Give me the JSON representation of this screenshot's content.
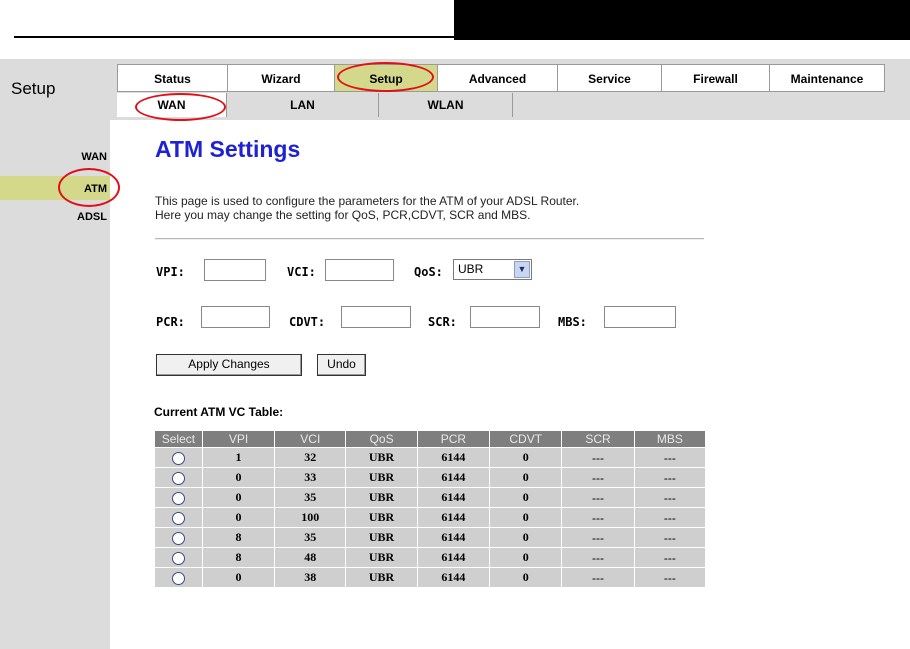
{
  "header": {
    "section_title": "Setup"
  },
  "main_tabs": [
    {
      "label": "Status",
      "active": false
    },
    {
      "label": "Wizard",
      "active": false
    },
    {
      "label": "Setup",
      "active": true
    },
    {
      "label": "Advanced",
      "active": false
    },
    {
      "label": "Service",
      "active": false
    },
    {
      "label": "Firewall",
      "active": false
    },
    {
      "label": "Maintenance",
      "active": false
    }
  ],
  "sub_tabs": [
    {
      "label": "WAN",
      "active": true
    },
    {
      "label": "LAN",
      "active": false
    },
    {
      "label": "WLAN",
      "active": false
    }
  ],
  "sidebar": {
    "items": [
      {
        "label": "WAN",
        "active": false
      },
      {
        "label": "ATM",
        "active": true
      },
      {
        "label": "ADSL",
        "active": false
      }
    ]
  },
  "page": {
    "title": "ATM Settings",
    "description_line1": "This page is used to configure the parameters for the ATM of your ADSL Router.",
    "description_line2": "Here you may change the setting for QoS, PCR,CDVT, SCR and MBS."
  },
  "form": {
    "vpi_label": "VPI:",
    "vpi_value": "",
    "vci_label": "VCI:",
    "vci_value": "",
    "qos_label": "QoS:",
    "qos_value": "UBR",
    "pcr_label": "PCR:",
    "pcr_value": "",
    "cdvt_label": "CDVT:",
    "cdvt_value": "",
    "scr_label": "SCR:",
    "scr_value": "",
    "mbs_label": "MBS:",
    "mbs_value": "",
    "apply_label": "Apply Changes",
    "undo_label": "Undo"
  },
  "table": {
    "caption": "Current ATM VC Table:",
    "headers": [
      "Select",
      "VPI",
      "VCI",
      "QoS",
      "PCR",
      "CDVT",
      "SCR",
      "MBS"
    ],
    "rows": [
      {
        "vpi": "1",
        "vci": "32",
        "qos": "UBR",
        "pcr": "6144",
        "cdvt": "0",
        "scr": "---",
        "mbs": "---"
      },
      {
        "vpi": "0",
        "vci": "33",
        "qos": "UBR",
        "pcr": "6144",
        "cdvt": "0",
        "scr": "---",
        "mbs": "---"
      },
      {
        "vpi": "0",
        "vci": "35",
        "qos": "UBR",
        "pcr": "6144",
        "cdvt": "0",
        "scr": "---",
        "mbs": "---"
      },
      {
        "vpi": "0",
        "vci": "100",
        "qos": "UBR",
        "pcr": "6144",
        "cdvt": "0",
        "scr": "---",
        "mbs": "---"
      },
      {
        "vpi": "8",
        "vci": "35",
        "qos": "UBR",
        "pcr": "6144",
        "cdvt": "0",
        "scr": "---",
        "mbs": "---"
      },
      {
        "vpi": "8",
        "vci": "48",
        "qos": "UBR",
        "pcr": "6144",
        "cdvt": "0",
        "scr": "---",
        "mbs": "---"
      },
      {
        "vpi": "0",
        "vci": "38",
        "qos": "UBR",
        "pcr": "6144",
        "cdvt": "0",
        "scr": "---",
        "mbs": "---"
      }
    ]
  },
  "colors": {
    "accent_title": "#1e22d4",
    "active_tab": "#d4d88a",
    "annotation_ring": "#e0101a",
    "band_gray": "#dcdcdc"
  },
  "icons": {
    "qos_dropdown": "chevron-down-icon",
    "row_select": "radio-icon"
  }
}
